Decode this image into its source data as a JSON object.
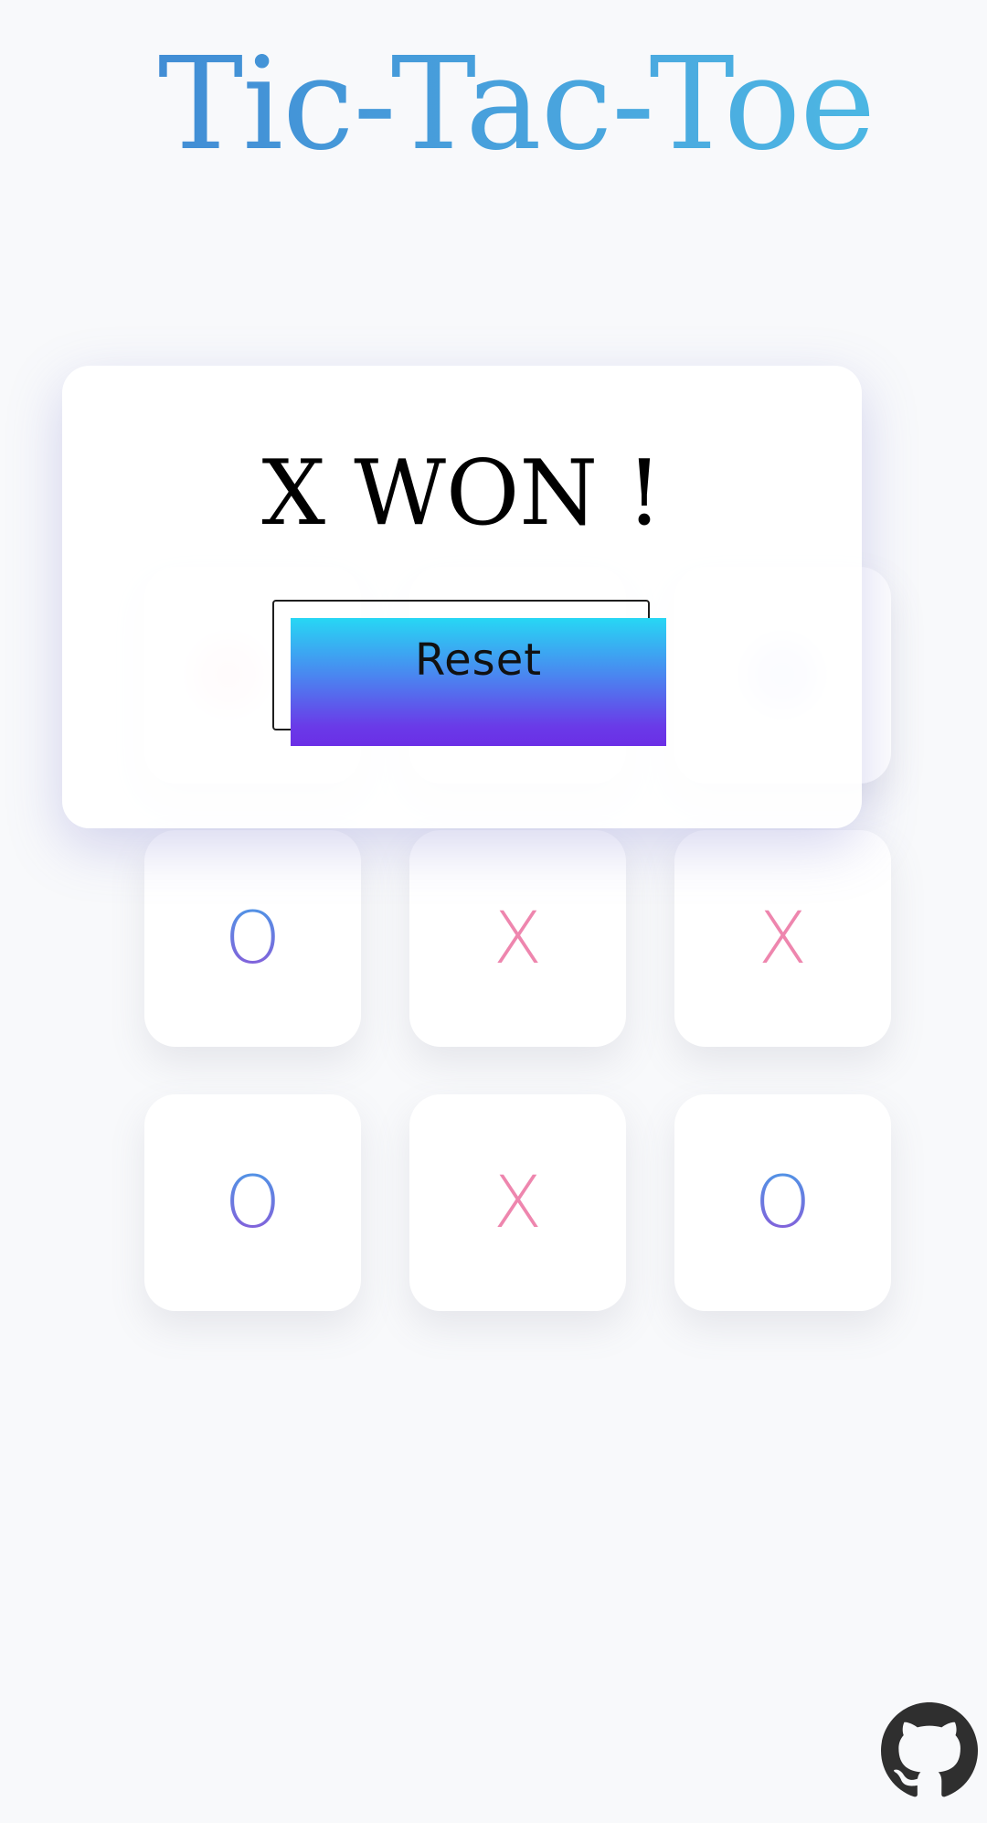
{
  "app": {
    "title": "Tic-Tac-Toe"
  },
  "board": {
    "cells": [
      {
        "row": 1,
        "col": 1,
        "value": ""
      },
      {
        "row": 1,
        "col": 2,
        "value": ""
      },
      {
        "row": 1,
        "col": 3,
        "value": ""
      },
      {
        "row": 2,
        "col": 1,
        "value": "O"
      },
      {
        "row": 2,
        "col": 2,
        "value": "X"
      },
      {
        "row": 2,
        "col": 3,
        "value": "X"
      },
      {
        "row": 3,
        "col": 1,
        "value": "O"
      },
      {
        "row": 3,
        "col": 2,
        "value": "X"
      },
      {
        "row": 3,
        "col": 3,
        "value": "O"
      }
    ]
  },
  "modal": {
    "result_text": "X WON !",
    "reset_label": "Reset"
  },
  "footer": {
    "icon": "github-icon"
  },
  "colors": {
    "x_mark": "#ee86ae",
    "o_mark_gradient": [
      "#4d97e6",
      "#8a5ad9"
    ],
    "button_gradient": [
      "#27d7f4",
      "#6b2ee6"
    ],
    "title_gradient": [
      "#3f84d1",
      "#4ec0e6"
    ],
    "background": "#f8f9fb"
  }
}
